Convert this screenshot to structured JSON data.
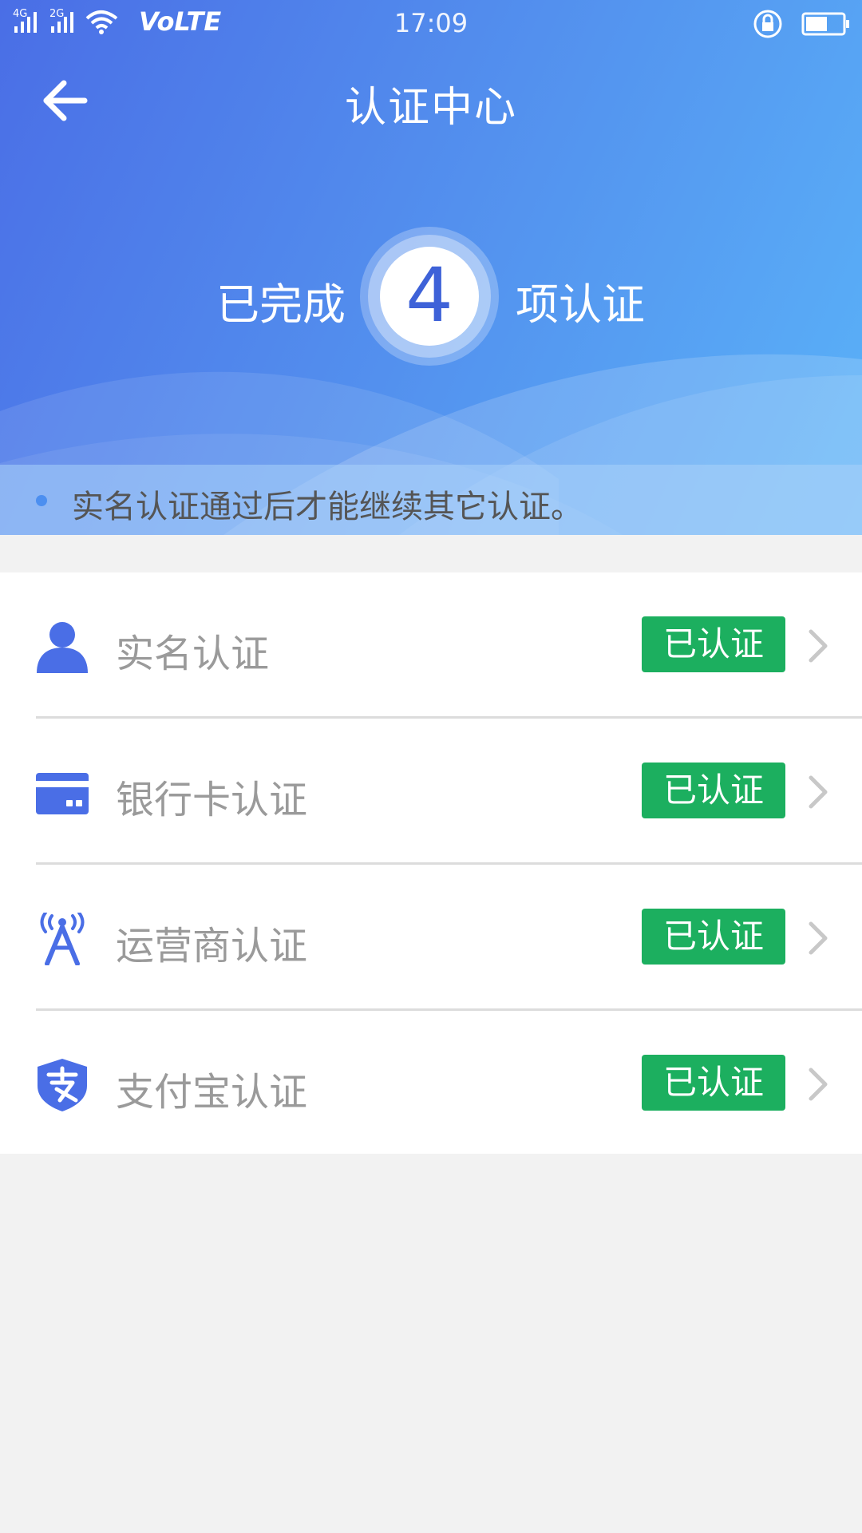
{
  "status_bar": {
    "network_1": "4G",
    "network_2": "2G",
    "volte": "VoLTE",
    "time": "17:09",
    "icons": [
      "signal-icon",
      "wifi-icon",
      "rotation-lock-icon",
      "battery-icon"
    ]
  },
  "header": {
    "title": "认证中心",
    "back_icon": "back-arrow-icon"
  },
  "summary": {
    "prefix": "已完成",
    "count": "4",
    "suffix": "项认证"
  },
  "notice": {
    "text": "实名认证通过后才能继续其它认证。"
  },
  "verifications": [
    {
      "label": "实名认证",
      "status": "已认证",
      "icon": "person-icon"
    },
    {
      "label": "银行卡认证",
      "status": "已认证",
      "icon": "bank-card-icon"
    },
    {
      "label": "运营商认证",
      "status": "已认证",
      "icon": "signal-tower-icon"
    },
    {
      "label": "支付宝认证",
      "status": "已认证",
      "icon": "alipay-shield-icon"
    }
  ],
  "colors": {
    "header_gradient_start": "#4a6ee6",
    "header_gradient_end": "#5ab2f8",
    "icon_blue": "#4a6ee6",
    "verified_green": "#1caf5f",
    "background": "#f2f2f2"
  }
}
